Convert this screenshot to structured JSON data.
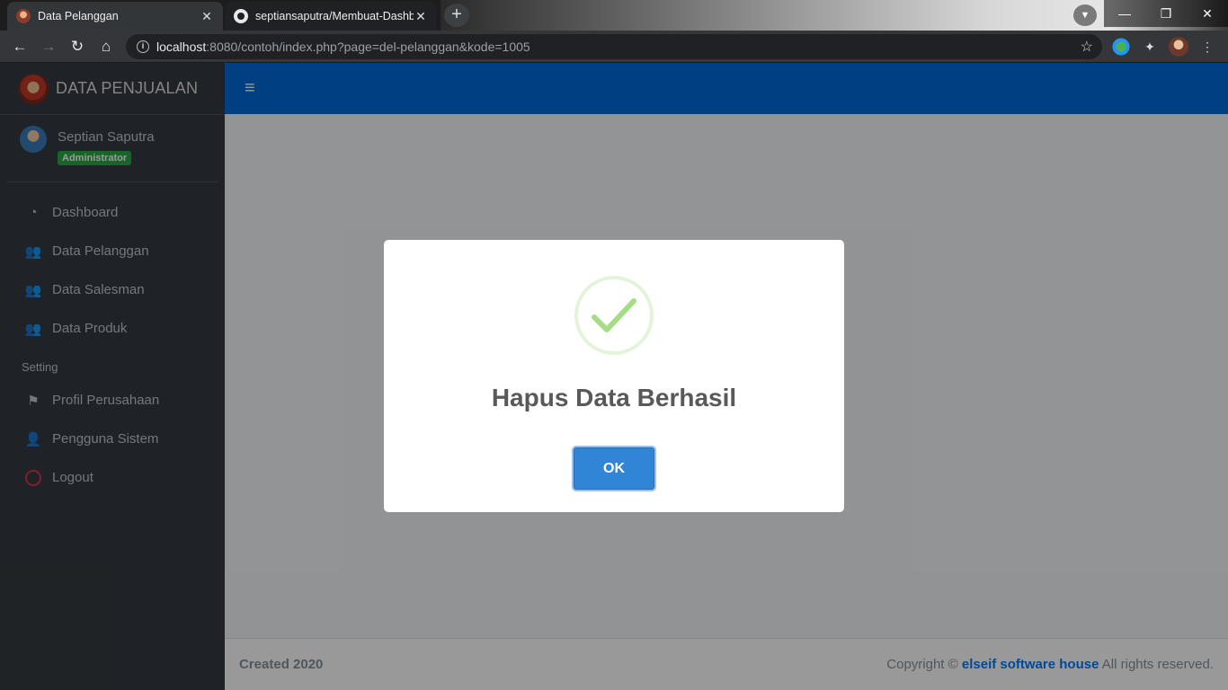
{
  "browser": {
    "tabs": [
      {
        "title": "Data Pelanggan",
        "active": true
      },
      {
        "title": "septiansaputra/Membuat-Dashb",
        "active": false
      }
    ],
    "new_tab": "+",
    "url_host": "localhost",
    "url_rest": ":8080/contoh/index.php?page=del-pelanggan&kode=1005",
    "window_controls": {
      "minimize": "—",
      "restore": "❐",
      "close": "✕"
    }
  },
  "sidebar": {
    "brand": "DATA PENJUALAN",
    "user": {
      "name": "Septian Saputra",
      "role": "Administrator"
    },
    "menu": [
      {
        "label": "Dashboard",
        "icon": "tachometer-icon"
      },
      {
        "label": "Data Pelanggan",
        "icon": "users-icon"
      },
      {
        "label": "Data Salesman",
        "icon": "users-icon"
      },
      {
        "label": "Data Produk",
        "icon": "users-icon"
      }
    ],
    "setting_header": "Setting",
    "setting_menu": [
      {
        "label": "Profil Perusahaan",
        "icon": "flag-icon"
      },
      {
        "label": "Pengguna Sistem",
        "icon": "user-icon"
      },
      {
        "label": "Logout",
        "icon": "logout-circle-icon"
      }
    ]
  },
  "footer": {
    "created": "Created 2020",
    "copyright_prefix": "Copyright ©",
    "company": "elseif software house",
    "copyright_suffix": "All rights reserved."
  },
  "modal": {
    "title": "Hapus Data Berhasil",
    "ok_label": "OK",
    "icon": "success-check-icon"
  },
  "colors": {
    "navbar": "#0069d9",
    "sidebar": "#343a40",
    "role_badge": "#28a745",
    "ok_button": "#3085d6",
    "success_check": "#a5dc86",
    "logout_icon": "#dc3545"
  }
}
